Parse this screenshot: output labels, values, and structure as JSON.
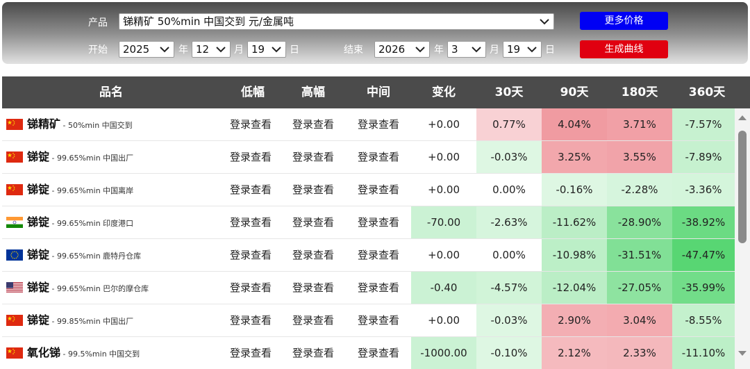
{
  "controls": {
    "product_label": "产品",
    "product_value": "锑精矿 50%min 中国交到 元/金属吨",
    "start_label": "开始",
    "start_year": "2025",
    "start_month": "12",
    "start_day": "19",
    "end_label": "结束",
    "end_year": "2026",
    "end_month": "3",
    "end_day": "19",
    "year_unit": "年",
    "month_unit": "月",
    "day_unit": "日",
    "more_prices_label": "更多价格",
    "generate_curve_label": "生成曲线"
  },
  "colors": {
    "more_prices_button": "#0000f4",
    "generate_curve_button": "#e00010",
    "header_bg": "#4b4b4b",
    "increase_strong": "#f0a7aa",
    "increase_light": "#f8cccf",
    "decrease_light": "#d8f5dc",
    "decrease_strong": "#5fd97a"
  },
  "table": {
    "headers": [
      "品名",
      "低幅",
      "高幅",
      "中间",
      "变化",
      "30天",
      "90天",
      "180天",
      "360天"
    ],
    "rows": [
      {
        "flag": "cn-flag",
        "name": "锑精矿",
        "spec": "50%min 中国交到",
        "low": "登录查看",
        "high": "登录查看",
        "mid": "登录查看",
        "change": "+0.00",
        "d30": "0.77%",
        "d90": "4.04%",
        "d180": "3.71%",
        "d360": "-7.57%"
      },
      {
        "flag": "cn-flag",
        "name": "锑锭",
        "spec": "99.65%min 中国出厂",
        "low": "登录查看",
        "high": "登录查看",
        "mid": "登录查看",
        "change": "+0.00",
        "d30": "-0.03%",
        "d90": "3.25%",
        "d180": "3.55%",
        "d360": "-7.89%"
      },
      {
        "flag": "cn-flag",
        "name": "锑锭",
        "spec": "99.65%min 中国离岸",
        "low": "登录查看",
        "high": "登录查看",
        "mid": "登录查看",
        "change": "+0.00",
        "d30": "0.00%",
        "d90": "-0.16%",
        "d180": "-2.28%",
        "d360": "-3.36%"
      },
      {
        "flag": "in-flag",
        "name": "锑锭",
        "spec": "99.65%min 印度港口",
        "low": "登录查看",
        "high": "登录查看",
        "mid": "登录查看",
        "change": "-70.00",
        "d30": "-2.63%",
        "d90": "-11.62%",
        "d180": "-28.90%",
        "d360": "-38.92%"
      },
      {
        "flag": "eu-flag",
        "name": "锑锭",
        "spec": "99.65%min 鹿特丹仓库",
        "low": "登录查看",
        "high": "登录查看",
        "mid": "登录查看",
        "change": "+0.00",
        "d30": "0.00%",
        "d90": "-10.98%",
        "d180": "-31.51%",
        "d360": "-47.47%"
      },
      {
        "flag": "us-flag",
        "name": "锑锭",
        "spec": "99.65%min 巴尔的摩仓库",
        "low": "登录查看",
        "high": "登录查看",
        "mid": "登录查看",
        "change": "-0.40",
        "d30": "-4.57%",
        "d90": "-12.04%",
        "d180": "-27.05%",
        "d360": "-35.99%"
      },
      {
        "flag": "cn-flag",
        "name": "锑锭",
        "spec": "99.85%min 中国出厂",
        "low": "登录查看",
        "high": "登录查看",
        "mid": "登录查看",
        "change": "+0.00",
        "d30": "-0.03%",
        "d90": "2.90%",
        "d180": "3.04%",
        "d360": "-8.55%"
      },
      {
        "flag": "cn-flag",
        "name": "氧化锑",
        "spec": "99.5%min 中国交到",
        "low": "登录查看",
        "high": "登录查看",
        "mid": "登录查看",
        "change": "-1000.00",
        "d30": "-0.10%",
        "d90": "2.12%",
        "d180": "2.33%",
        "d360": "-11.10%"
      }
    ]
  }
}
